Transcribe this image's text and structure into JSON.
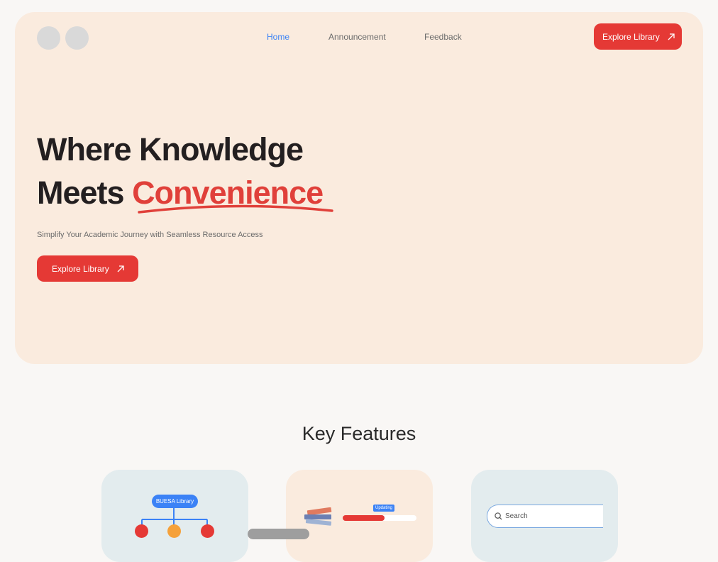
{
  "nav": {
    "links": [
      {
        "label": "Home"
      },
      {
        "label": "Announcement"
      },
      {
        "label": "Feedback"
      }
    ],
    "cta_label": "Explore Library"
  },
  "hero": {
    "line1": "Where Knowledge",
    "line2_prefix": "Meets ",
    "line2_accent": "Convenience",
    "subtitle": "Simplify Your Academic Journey with Seamless Resource Access",
    "cta_label": "Explore Library"
  },
  "features": {
    "title": "Key Features",
    "card1": {
      "pill_label": "BUESA Library"
    },
    "card2": {
      "badge_label": "Updating",
      "progress": 0.57
    },
    "card3": {
      "search_placeholder": "Search"
    }
  },
  "colors": {
    "brand_red": "#e53935",
    "accent_blue": "#3b82f6",
    "hero_bg": "#faebde"
  }
}
